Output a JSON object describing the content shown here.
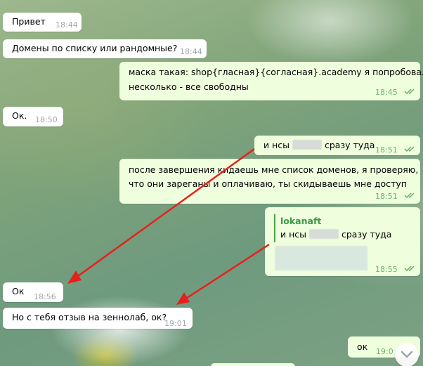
{
  "messages": [
    {
      "id": "m1",
      "dir": "in",
      "text": "Привет",
      "time": "18:44"
    },
    {
      "id": "m2",
      "dir": "in",
      "text": "Домены по списку или рандомные?",
      "time": "18:44"
    },
    {
      "id": "m3",
      "dir": "out",
      "line1": "маска такая: shop{гласная}{согласная}.academy я попробовал",
      "line2": "несколько - все свободны",
      "time": "18:45"
    },
    {
      "id": "m4",
      "dir": "in",
      "text": "Ок.",
      "time": "18:50"
    },
    {
      "id": "m5",
      "dir": "out",
      "before": "и нсы",
      "after": "сразу туда",
      "time": "18:51"
    },
    {
      "id": "m6",
      "dir": "out",
      "line1": "после завершения кидаешь мне список доменов, я проверяю,",
      "line2": "что они зареганы и оплачиваю, ты скидываешь мне доступ",
      "time": "18:51"
    },
    {
      "id": "m7",
      "dir": "out",
      "reply_author": "lokanaft",
      "reply_before": "и нсы",
      "reply_after": "сразу туда",
      "time": "18:55"
    },
    {
      "id": "m8",
      "dir": "in",
      "text": "Ок",
      "time": "18:56"
    },
    {
      "id": "m9",
      "dir": "in",
      "text": "Но с тебя отзыв на зеннолаб, ок?",
      "time": "19:01"
    },
    {
      "id": "m10",
      "dir": "out",
      "text": "ок",
      "time": "19:0"
    }
  ],
  "annotation_color": "#e8201c"
}
